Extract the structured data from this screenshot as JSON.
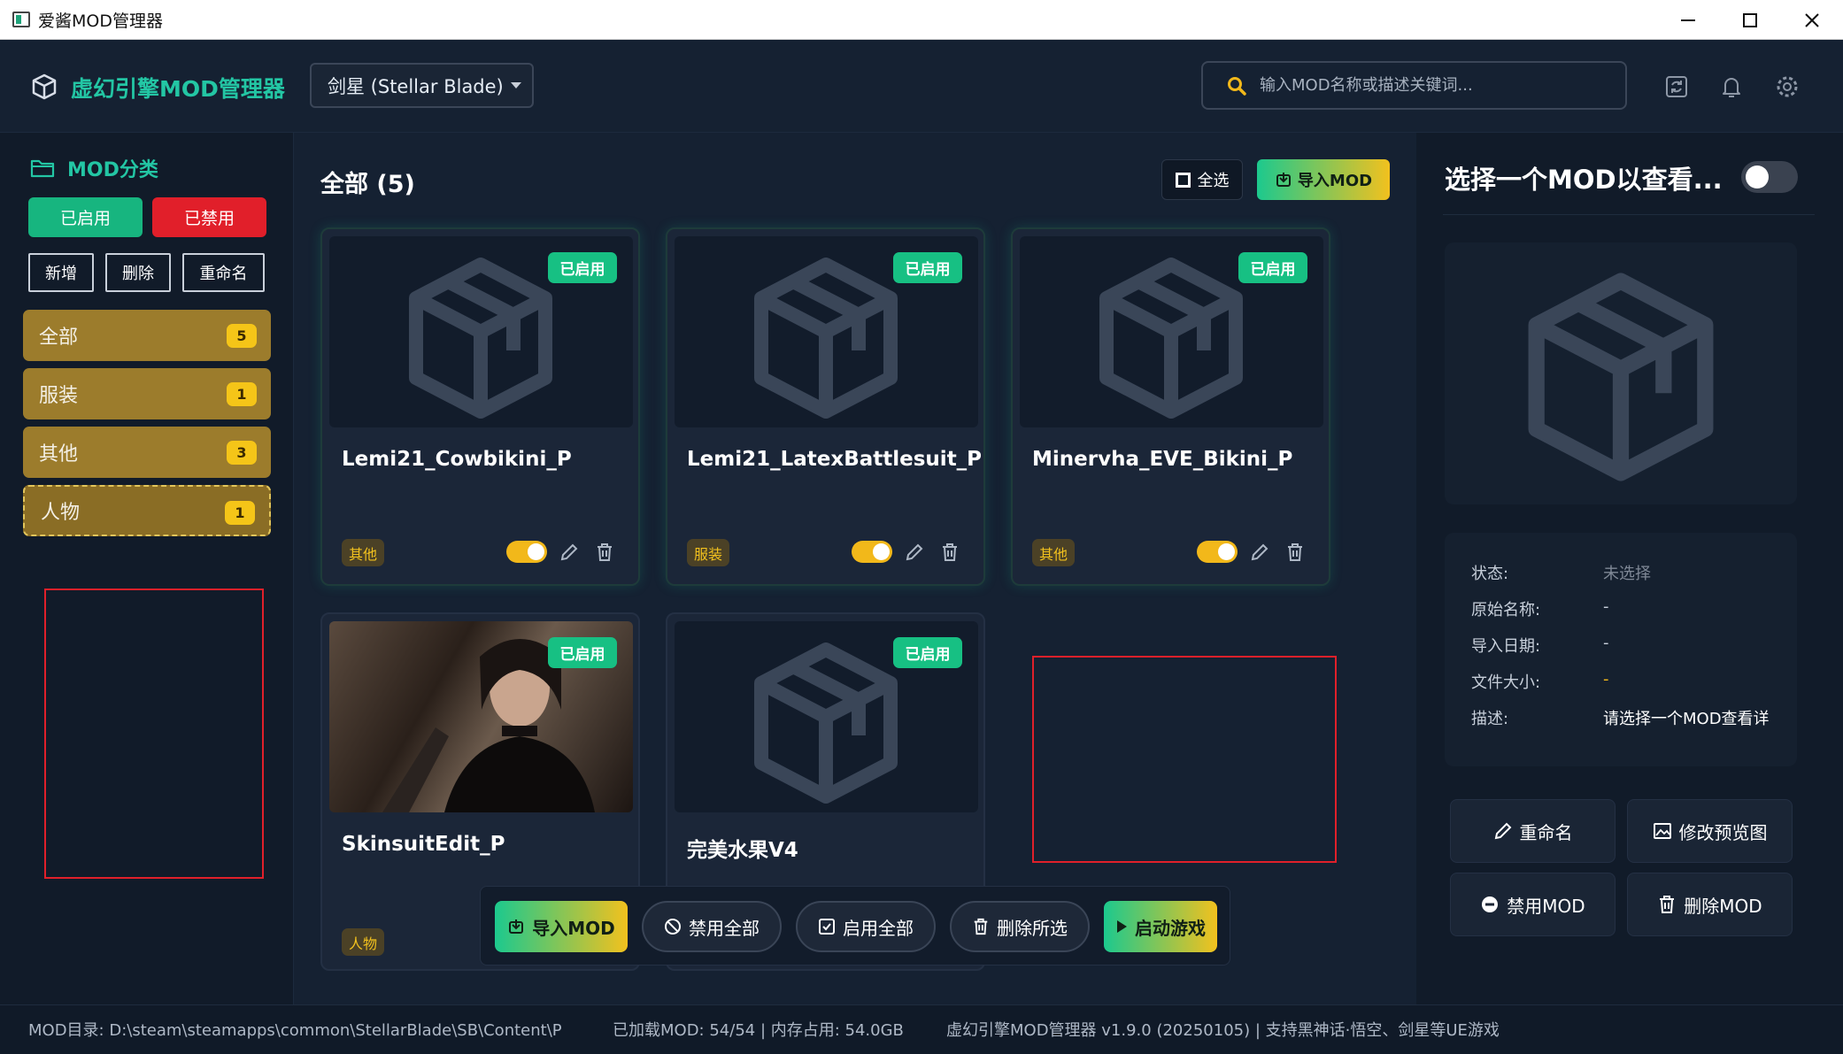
{
  "window": {
    "title": "爱酱MOD管理器",
    "minimize": "—",
    "maximize": "☐",
    "close": "✕"
  },
  "header": {
    "logo_text": "虚幻引擎MOD管理器",
    "game_select": "剑星 (Stellar Blade)",
    "search_placeholder": "输入MOD名称或描述关键词..."
  },
  "sidebar": {
    "heading": "MOD分类",
    "filter_enabled": "已启用",
    "filter_disabled": "已禁用",
    "add": "新增",
    "delete": "删除",
    "rename": "重命名",
    "categories": [
      {
        "label": "全部",
        "count": "5"
      },
      {
        "label": "服装",
        "count": "1"
      },
      {
        "label": "其他",
        "count": "3"
      },
      {
        "label": "人物",
        "count": "1"
      }
    ]
  },
  "main": {
    "title": "全部 (5)",
    "select_all": "全选",
    "import": "导入MOD",
    "mods": [
      {
        "name": "Lemi21_Cowbikini_P",
        "badge": "已启用",
        "tag": "其他"
      },
      {
        "name": "Lemi21_LatexBattlesuit_P",
        "badge": "已启用",
        "tag": "服装"
      },
      {
        "name": "Minervha_EVE_Bikini_P",
        "badge": "已启用",
        "tag": "其他"
      },
      {
        "name": "SkinsuitEdit_P",
        "badge": "已启用",
        "tag": "人物"
      },
      {
        "name": "完美水果V4",
        "badge": "已启用",
        "tag": ""
      }
    ],
    "bottom": {
      "import": "导入MOD",
      "disable_all": "禁用全部",
      "enable_all": "启用全部",
      "delete_selected": "删除所选",
      "launch": "启动游戏"
    }
  },
  "details": {
    "title": "选择一个MOD以查看...",
    "rows": [
      {
        "label": "状态:",
        "value": "未选择"
      },
      {
        "label": "原始名称:",
        "value": "-"
      },
      {
        "label": "导入日期:",
        "value": "-"
      },
      {
        "label": "文件大小:",
        "value": "-"
      },
      {
        "label": "描述:",
        "value": "请选择一个MOD查看详"
      }
    ],
    "rename": "重命名",
    "edit_preview": "修改预览图",
    "disable": "禁用MOD",
    "delete": "删除MOD"
  },
  "status": {
    "mod_dir": "MOD目录: D:\\steam\\steamapps\\common\\StellarBlade\\SB\\Content\\Pal",
    "loaded": "已加载MOD: 54/54 | 内存占用: 54.0GB",
    "version": "虚幻引擎MOD管理器 v1.9.0 (20250105) | 支持黑神话·悟空、剑星等UE游戏"
  },
  "colors": {
    "accent": "#23c6a4",
    "enabled_green": "#17c083",
    "danger_red": "#e11f2a",
    "category_gold": "#9c7c2c",
    "toggle_yellow": "#f2b81a"
  }
}
